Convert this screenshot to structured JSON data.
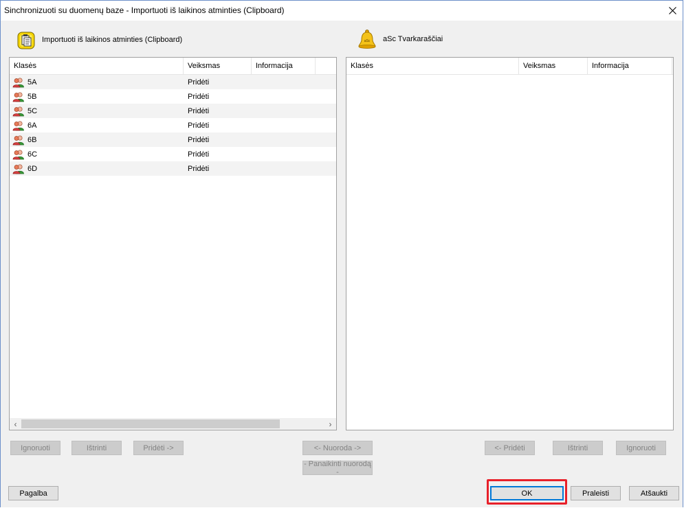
{
  "window": {
    "title": "Sinchronizuoti su duomenų baze - Importuoti iš laikinos atminties (Clipboard)"
  },
  "left_pane": {
    "header": "Importuoti iš laikinos atminties (Clipboard)",
    "icon": "clipboard-icon",
    "columns": [
      "Klasės",
      "Veiksmas",
      "Informacija"
    ],
    "rows": [
      {
        "name": "5A",
        "action": "Pridėti",
        "info": ""
      },
      {
        "name": "5B",
        "action": "Pridėti",
        "info": ""
      },
      {
        "name": "5C",
        "action": "Pridėti",
        "info": ""
      },
      {
        "name": "6A",
        "action": "Pridėti",
        "info": ""
      },
      {
        "name": "6B",
        "action": "Pridėti",
        "info": ""
      },
      {
        "name": "6C",
        "action": "Pridėti",
        "info": ""
      },
      {
        "name": "6D",
        "action": "Pridėti",
        "info": ""
      }
    ]
  },
  "right_pane": {
    "header": "aSc Tvarkaraščiai",
    "icon": "bell-icon",
    "bell_text": "aSc",
    "columns": [
      "Klasės",
      "Veiksmas",
      "Informacija"
    ],
    "rows": []
  },
  "buttons": {
    "ignore_left": "Ignoruoti",
    "delete_left": "Ištrinti",
    "add_right": "Pridėti ->",
    "link": "<- Nuoroda ->",
    "unlink": "- Panaikinti nuorodą -",
    "add_left": "<- Pridėti",
    "delete_right": "Ištrinti",
    "ignore_right": "Ignoruoti",
    "help": "Pagalba",
    "ok": "OK",
    "skip": "Praleisti",
    "cancel": "Atšaukti"
  },
  "colors": {
    "highlight": "#e8202a",
    "focus": "#0078d7"
  }
}
